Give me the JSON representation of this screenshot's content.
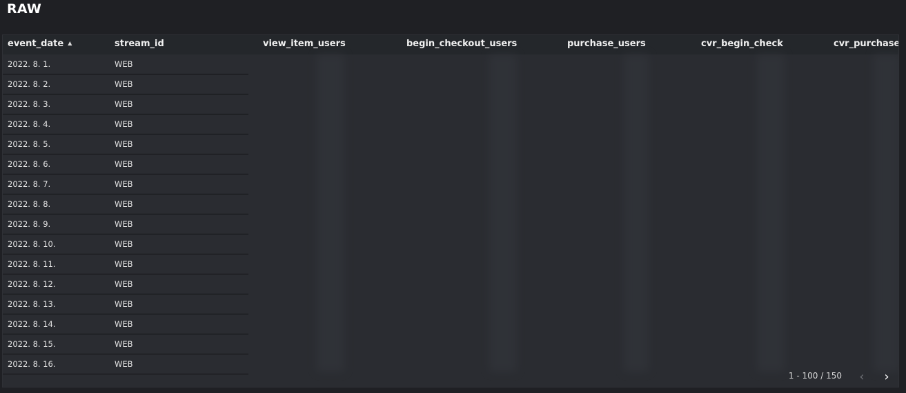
{
  "page": {
    "title": "RAW"
  },
  "table": {
    "columns": [
      {
        "key": "event_date",
        "label": "event_date",
        "sorted": "asc"
      },
      {
        "key": "stream_id",
        "label": "stream_id"
      },
      {
        "key": "view_item_users",
        "label": "view_item_users"
      },
      {
        "key": "begin_checkout_users",
        "label": "begin_checkout_users"
      },
      {
        "key": "purchase_users",
        "label": "purchase_users"
      },
      {
        "key": "cvr_begin_check",
        "label": "cvr_begin_check"
      },
      {
        "key": "cvr_purchase",
        "label": "cvr_purchase"
      }
    ],
    "rows": [
      {
        "event_date": "2022. 8. 1.",
        "stream_id": "WEB"
      },
      {
        "event_date": "2022. 8. 2.",
        "stream_id": "WEB"
      },
      {
        "event_date": "2022. 8. 3.",
        "stream_id": "WEB"
      },
      {
        "event_date": "2022. 8. 4.",
        "stream_id": "WEB"
      },
      {
        "event_date": "2022. 8. 5.",
        "stream_id": "WEB"
      },
      {
        "event_date": "2022. 8. 6.",
        "stream_id": "WEB"
      },
      {
        "event_date": "2022. 8. 7.",
        "stream_id": "WEB"
      },
      {
        "event_date": "2022. 8. 8.",
        "stream_id": "WEB"
      },
      {
        "event_date": "2022. 8. 9.",
        "stream_id": "WEB"
      },
      {
        "event_date": "2022. 8. 10.",
        "stream_id": "WEB"
      },
      {
        "event_date": "2022. 8. 11.",
        "stream_id": "WEB"
      },
      {
        "event_date": "2022. 8. 12.",
        "stream_id": "WEB"
      },
      {
        "event_date": "2022. 8. 13.",
        "stream_id": "WEB"
      },
      {
        "event_date": "2022. 8. 14.",
        "stream_id": "WEB"
      },
      {
        "event_date": "2022. 8. 15.",
        "stream_id": "WEB"
      },
      {
        "event_date": "2022. 8. 16.",
        "stream_id": "WEB"
      }
    ]
  },
  "pagination": {
    "range": "1 - 100 / 150",
    "prev_icon": "chevron-left-icon",
    "next_icon": "chevron-right-icon"
  },
  "colors": {
    "background": "#1f2024",
    "panel": "#2a2c31",
    "header": "#24272b"
  }
}
